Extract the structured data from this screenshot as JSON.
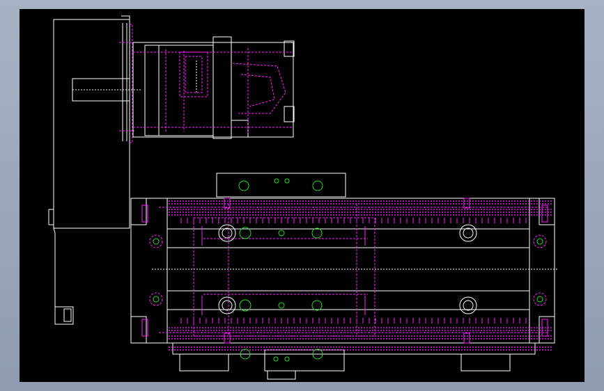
{
  "colors": {
    "window_background": "#97a4b7",
    "drawing_background": "#000000",
    "outline": "#ffffff",
    "hidden_lines": "#ff22ff",
    "holes": "#22dd22"
  },
  "drawing": {
    "views": [
      "motor-side-view",
      "gearbox-view",
      "linear-module-top-view"
    ],
    "annotations": []
  }
}
